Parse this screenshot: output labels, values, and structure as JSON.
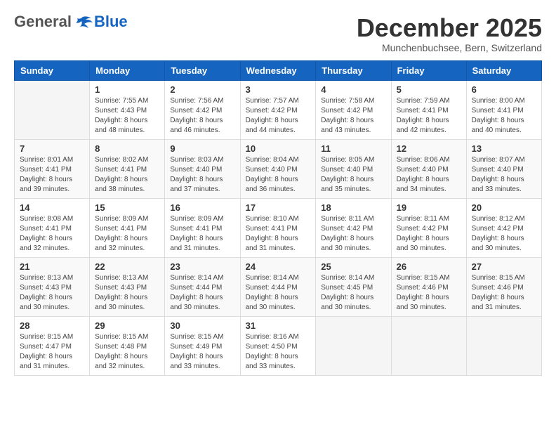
{
  "header": {
    "logo_general": "General",
    "logo_blue": "Blue",
    "month": "December 2025",
    "location": "Munchenbuchsee, Bern, Switzerland"
  },
  "weekdays": [
    "Sunday",
    "Monday",
    "Tuesday",
    "Wednesday",
    "Thursday",
    "Friday",
    "Saturday"
  ],
  "weeks": [
    [
      {
        "num": "",
        "info": ""
      },
      {
        "num": "1",
        "info": "Sunrise: 7:55 AM\nSunset: 4:43 PM\nDaylight: 8 hours\nand 48 minutes."
      },
      {
        "num": "2",
        "info": "Sunrise: 7:56 AM\nSunset: 4:42 PM\nDaylight: 8 hours\nand 46 minutes."
      },
      {
        "num": "3",
        "info": "Sunrise: 7:57 AM\nSunset: 4:42 PM\nDaylight: 8 hours\nand 44 minutes."
      },
      {
        "num": "4",
        "info": "Sunrise: 7:58 AM\nSunset: 4:42 PM\nDaylight: 8 hours\nand 43 minutes."
      },
      {
        "num": "5",
        "info": "Sunrise: 7:59 AM\nSunset: 4:41 PM\nDaylight: 8 hours\nand 42 minutes."
      },
      {
        "num": "6",
        "info": "Sunrise: 8:00 AM\nSunset: 4:41 PM\nDaylight: 8 hours\nand 40 minutes."
      }
    ],
    [
      {
        "num": "7",
        "info": "Sunrise: 8:01 AM\nSunset: 4:41 PM\nDaylight: 8 hours\nand 39 minutes."
      },
      {
        "num": "8",
        "info": "Sunrise: 8:02 AM\nSunset: 4:41 PM\nDaylight: 8 hours\nand 38 minutes."
      },
      {
        "num": "9",
        "info": "Sunrise: 8:03 AM\nSunset: 4:40 PM\nDaylight: 8 hours\nand 37 minutes."
      },
      {
        "num": "10",
        "info": "Sunrise: 8:04 AM\nSunset: 4:40 PM\nDaylight: 8 hours\nand 36 minutes."
      },
      {
        "num": "11",
        "info": "Sunrise: 8:05 AM\nSunset: 4:40 PM\nDaylight: 8 hours\nand 35 minutes."
      },
      {
        "num": "12",
        "info": "Sunrise: 8:06 AM\nSunset: 4:40 PM\nDaylight: 8 hours\nand 34 minutes."
      },
      {
        "num": "13",
        "info": "Sunrise: 8:07 AM\nSunset: 4:40 PM\nDaylight: 8 hours\nand 33 minutes."
      }
    ],
    [
      {
        "num": "14",
        "info": "Sunrise: 8:08 AM\nSunset: 4:41 PM\nDaylight: 8 hours\nand 32 minutes."
      },
      {
        "num": "15",
        "info": "Sunrise: 8:09 AM\nSunset: 4:41 PM\nDaylight: 8 hours\nand 32 minutes."
      },
      {
        "num": "16",
        "info": "Sunrise: 8:09 AM\nSunset: 4:41 PM\nDaylight: 8 hours\nand 31 minutes."
      },
      {
        "num": "17",
        "info": "Sunrise: 8:10 AM\nSunset: 4:41 PM\nDaylight: 8 hours\nand 31 minutes."
      },
      {
        "num": "18",
        "info": "Sunrise: 8:11 AM\nSunset: 4:42 PM\nDaylight: 8 hours\nand 30 minutes."
      },
      {
        "num": "19",
        "info": "Sunrise: 8:11 AM\nSunset: 4:42 PM\nDaylight: 8 hours\nand 30 minutes."
      },
      {
        "num": "20",
        "info": "Sunrise: 8:12 AM\nSunset: 4:42 PM\nDaylight: 8 hours\nand 30 minutes."
      }
    ],
    [
      {
        "num": "21",
        "info": "Sunrise: 8:13 AM\nSunset: 4:43 PM\nDaylight: 8 hours\nand 30 minutes."
      },
      {
        "num": "22",
        "info": "Sunrise: 8:13 AM\nSunset: 4:43 PM\nDaylight: 8 hours\nand 30 minutes."
      },
      {
        "num": "23",
        "info": "Sunrise: 8:14 AM\nSunset: 4:44 PM\nDaylight: 8 hours\nand 30 minutes."
      },
      {
        "num": "24",
        "info": "Sunrise: 8:14 AM\nSunset: 4:44 PM\nDaylight: 8 hours\nand 30 minutes."
      },
      {
        "num": "25",
        "info": "Sunrise: 8:14 AM\nSunset: 4:45 PM\nDaylight: 8 hours\nand 30 minutes."
      },
      {
        "num": "26",
        "info": "Sunrise: 8:15 AM\nSunset: 4:46 PM\nDaylight: 8 hours\nand 30 minutes."
      },
      {
        "num": "27",
        "info": "Sunrise: 8:15 AM\nSunset: 4:46 PM\nDaylight: 8 hours\nand 31 minutes."
      }
    ],
    [
      {
        "num": "28",
        "info": "Sunrise: 8:15 AM\nSunset: 4:47 PM\nDaylight: 8 hours\nand 31 minutes."
      },
      {
        "num": "29",
        "info": "Sunrise: 8:15 AM\nSunset: 4:48 PM\nDaylight: 8 hours\nand 32 minutes."
      },
      {
        "num": "30",
        "info": "Sunrise: 8:15 AM\nSunset: 4:49 PM\nDaylight: 8 hours\nand 33 minutes."
      },
      {
        "num": "31",
        "info": "Sunrise: 8:16 AM\nSunset: 4:50 PM\nDaylight: 8 hours\nand 33 minutes."
      },
      {
        "num": "",
        "info": ""
      },
      {
        "num": "",
        "info": ""
      },
      {
        "num": "",
        "info": ""
      }
    ]
  ]
}
